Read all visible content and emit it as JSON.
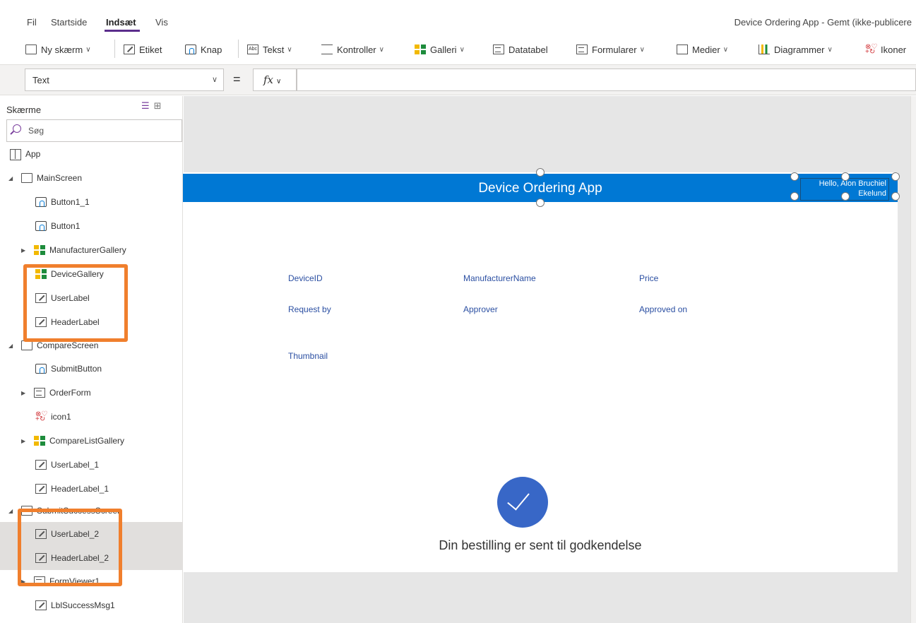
{
  "menu": {
    "items": [
      "Fil",
      "Startside",
      "Indsæt",
      "Vis"
    ],
    "active": "Indsæt",
    "doc_title": "Device Ordering App - Gemt (ikke-publicere"
  },
  "ribbon": {
    "new_screen": "Ny skærm",
    "label": "Etiket",
    "button": "Knap",
    "text": "Tekst",
    "controls": "Kontroller",
    "gallery": "Galleri",
    "datatable": "Datatabel",
    "forms": "Formularer",
    "media": "Medier",
    "charts": "Diagrammer",
    "icons": "Ikoner"
  },
  "formula": {
    "property": "Text",
    "equals": "=",
    "fx": "fx",
    "value": ""
  },
  "tree": {
    "title": "Skærme",
    "search_placeholder": "Søg",
    "nodes": {
      "app": "App",
      "main_screen": "MainScreen",
      "button1_1": "Button1_1",
      "button1": "Button1",
      "manufacturer_gallery": "ManufacturerGallery",
      "device_gallery": "DeviceGallery",
      "user_label": "UserLabel",
      "header_label": "HeaderLabel",
      "compare_screen": "CompareScreen",
      "submit_button": "SubmitButton",
      "order_form": "OrderForm",
      "icon1": "icon1",
      "compare_list_gallery": "CompareListGallery",
      "user_label_1": "UserLabel_1",
      "header_label_1": "HeaderLabel_1",
      "submit_screen": "SubmitSuccessScreen",
      "user_label_2": "UserLabel_2",
      "header_label_2": "HeaderLabel_2",
      "form_viewer": "FormViewer1",
      "lbl_success": "LblSuccessMsg1"
    }
  },
  "canvas": {
    "header_title": "Device Ordering App",
    "user_label": "Hello, Alon Bruchiel Ekelund",
    "fields": {
      "device_id": "DeviceID",
      "manufacturer_name": "ManufacturerName",
      "price": "Price",
      "request_by": "Request by",
      "approver": "Approver",
      "approved_on": "Approved on",
      "thumbnail": "Thumbnail"
    },
    "success_message": "Din bestilling er sent til godkendelse"
  },
  "colors": {
    "header_blue": "#0078d4",
    "highlight_orange": "#f07f2d",
    "check_blue": "#3867c7",
    "accent_purple": "#5b2d8c"
  }
}
